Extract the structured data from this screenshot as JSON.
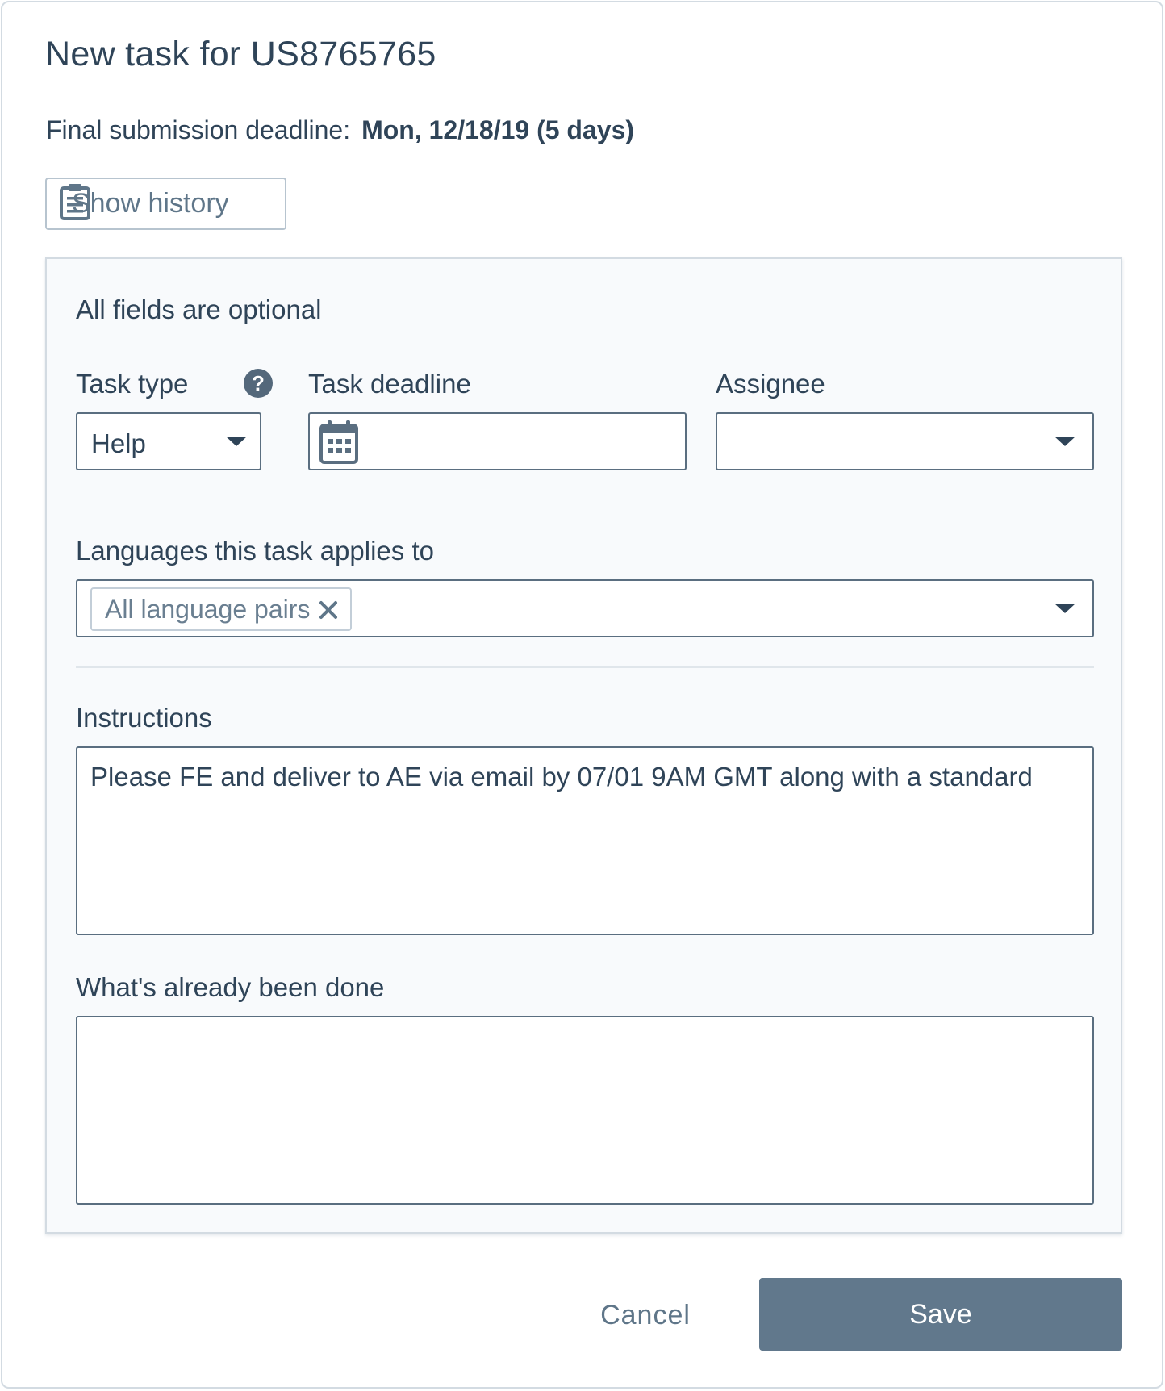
{
  "dialog": {
    "title": "New task for US8765765",
    "deadline_label": "Final submission  deadline:",
    "deadline_value": "Mon, 12/18/19 (5 days)",
    "history_button": "Show history"
  },
  "form": {
    "subtitle": "All fields are optional",
    "task_type": {
      "label": "Task type",
      "value": "Help"
    },
    "task_deadline": {
      "label": "Task deadline",
      "value": ""
    },
    "assignee": {
      "label": "Assignee",
      "value": ""
    },
    "languages": {
      "label": "Languages this task applies to",
      "chips": [
        "All language pairs"
      ]
    },
    "instructions": {
      "label": "Instructions",
      "value": "Please FE and deliver to AE via email by 07/01 9AM GMT along with a standard"
    },
    "done": {
      "label": "What's already been done",
      "value": ""
    }
  },
  "actions": {
    "cancel": "Cancel",
    "save": "Save"
  },
  "icons": {
    "history": "clipboard-icon",
    "help": "question-circle-icon",
    "calendar": "calendar-icon",
    "dropdown": "caret-down-icon",
    "remove": "close-icon"
  },
  "colors": {
    "text": "#2f4458",
    "muted": "#5f7689",
    "primary_button": "#61788c",
    "panel_bg": "#f8fafc",
    "border": "#5a6e80"
  }
}
